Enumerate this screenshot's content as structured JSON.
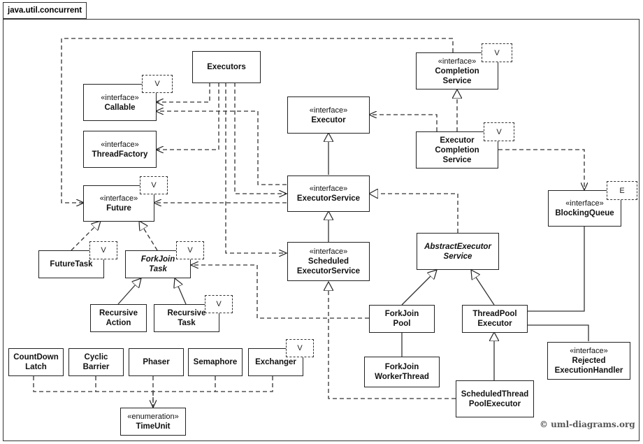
{
  "package": {
    "name": "java.util.concurrent"
  },
  "copyright": "© uml-diagrams.org",
  "classes": {
    "executors": {
      "name": "Executors"
    },
    "callable": {
      "stereotype": "«interface»",
      "name": "Callable",
      "template_param": "V"
    },
    "threadfactory": {
      "stereotype": "«interface»",
      "name": "ThreadFactory"
    },
    "future": {
      "stereotype": "«interface»",
      "name": "Future",
      "template_param": "V"
    },
    "futuretask": {
      "name": "FutureTask",
      "template_param": "V"
    },
    "forkjointask": {
      "name": "ForkJoin\nTask",
      "template_param": "V",
      "abstract": true
    },
    "recursiveaction": {
      "name": "Recursive\nAction"
    },
    "recursivetask": {
      "name": "Recursive\nTask",
      "template_param": "V"
    },
    "executor": {
      "stereotype": "«interface»",
      "name": "Executor"
    },
    "executorservice": {
      "stereotype": "«interface»",
      "name": "ExecutorService"
    },
    "scheduledexecutorservice": {
      "stereotype": "«interface»",
      "name": "Scheduled\nExecutorService"
    },
    "completionservice": {
      "stereotype": "«interface»",
      "name": "Completion\nService",
      "template_param": "V"
    },
    "executorcompletionservice": {
      "name": "Executor\nCompletion\nService",
      "template_param": "V"
    },
    "blockingqueue": {
      "stereotype": "«interface»",
      "name": "BlockingQueue",
      "template_param": "E"
    },
    "abstractexecutorservice": {
      "name": "AbstractExecutor\nService",
      "abstract": true
    },
    "forkjoinpool": {
      "name": "ForkJoin\nPool"
    },
    "threadpoolexecutor": {
      "name": "ThreadPool\nExecutor"
    },
    "forkjoinworkerthread": {
      "name": "ForkJoin\nWorkerThread"
    },
    "rejectedexecutionhandler": {
      "stereotype": "«interface»",
      "name": "Rejected\nExecutionHandler"
    },
    "scheduledthreadpoolexecutor": {
      "name": "ScheduledThread\nPoolExecutor"
    },
    "countdownlatch": {
      "name": "CountDown\nLatch"
    },
    "cyclicbarrier": {
      "name": "Cyclic\nBarrier"
    },
    "phaser": {
      "name": "Phaser"
    },
    "semaphore": {
      "name": "Semaphore"
    },
    "exchanger": {
      "name": "Exchanger",
      "template_param": "V"
    },
    "timeunit": {
      "stereotype": "«enumeration»",
      "name": "TimeUnit"
    }
  },
  "relationships": [
    {
      "type": "dependency",
      "from": "executors",
      "to": "callable"
    },
    {
      "type": "dependency",
      "from": "executors",
      "to": "threadfactory"
    },
    {
      "type": "dependency",
      "from": "executors",
      "to": "executorservice"
    },
    {
      "type": "dependency",
      "from": "executors",
      "to": "scheduledexecutorservice"
    },
    {
      "type": "dependency",
      "from": "executorservice",
      "to": "callable"
    },
    {
      "type": "dependency",
      "from": "executorservice",
      "to": "future"
    },
    {
      "type": "dependency",
      "from": "completionservice",
      "to": "future"
    },
    {
      "type": "dependency",
      "from": "executorcompletionservice",
      "to": "executor"
    },
    {
      "type": "dependency",
      "from": "executorcompletionservice",
      "to": "blockingqueue"
    },
    {
      "type": "dependency",
      "from": "forkjoinpool",
      "to": "forkjointask"
    },
    {
      "type": "generalization",
      "from": "executorservice",
      "to": "executor"
    },
    {
      "type": "generalization",
      "from": "scheduledexecutorservice",
      "to": "executorservice"
    },
    {
      "type": "realization",
      "from": "executorcompletionservice",
      "to": "completionservice"
    },
    {
      "type": "realization",
      "from": "abstractexecutorservice",
      "to": "executorservice"
    },
    {
      "type": "realization",
      "from": "futuretask",
      "to": "future"
    },
    {
      "type": "realization",
      "from": "forkjointask",
      "to": "future"
    },
    {
      "type": "generalization",
      "from": "recursiveaction",
      "to": "forkjointask"
    },
    {
      "type": "generalization",
      "from": "recursivetask",
      "to": "forkjointask"
    },
    {
      "type": "generalization",
      "from": "forkjoinpool",
      "to": "abstractexecutorservice"
    },
    {
      "type": "generalization",
      "from": "threadpoolexecutor",
      "to": "abstractexecutorservice"
    },
    {
      "type": "generalization",
      "from": "scheduledthreadpoolexecutor",
      "to": "threadpoolexecutor"
    },
    {
      "type": "realization",
      "from": "scheduledthreadpoolexecutor",
      "to": "scheduledexecutorservice"
    },
    {
      "type": "aggregation",
      "from": "forkjoinpool",
      "to": "forkjoinworkerthread"
    },
    {
      "type": "aggregation",
      "from": "threadpoolexecutor",
      "to": "blockingqueue"
    },
    {
      "type": "aggregation",
      "from": "threadpoolexecutor",
      "to": "rejectedexecutionhandler"
    },
    {
      "type": "dependency",
      "from": "countdownlatch",
      "to": "timeunit"
    },
    {
      "type": "dependency",
      "from": "cyclicbarrier",
      "to": "timeunit"
    },
    {
      "type": "dependency",
      "from": "phaser",
      "to": "timeunit"
    },
    {
      "type": "dependency",
      "from": "semaphore",
      "to": "timeunit"
    },
    {
      "type": "dependency",
      "from": "exchanger",
      "to": "timeunit"
    }
  ]
}
